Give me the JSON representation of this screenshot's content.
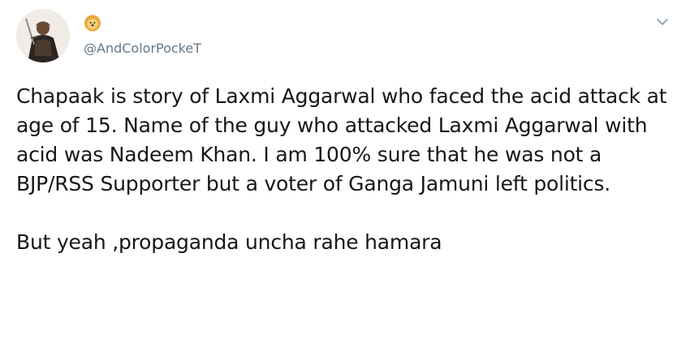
{
  "user": {
    "handle": "@AndColorPockeT",
    "name_icon": "lion-face-icon"
  },
  "menu": {
    "icon": "chevron-down-icon"
  },
  "tweet": {
    "paragraph1": "Chapaak is story of Laxmi Aggarwal who faced the acid attack at age of 15. Name of the guy who attacked Laxmi Aggarwal with acid was Nadeem Khan. I am 100% sure that he was not a BJP/RSS Supporter but a voter of Ganga Jamuni left politics.",
    "paragraph2": "But yeah ,propaganda uncha rahe hamara"
  },
  "colors": {
    "text": "#14171a",
    "secondary_text": "#657786",
    "background": "#ffffff"
  }
}
